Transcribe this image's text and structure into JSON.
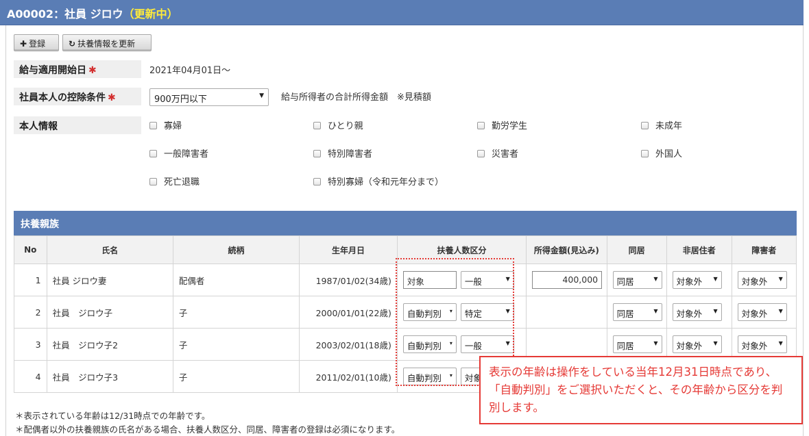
{
  "header": {
    "code": "A00002",
    "separator": "：",
    "name": "社員 ジロウ",
    "status": "（更新中）"
  },
  "toolbar": {
    "register": "登録",
    "update_dependents": "扶養情報を更新"
  },
  "pay_start": {
    "label": "給与適用開始日",
    "required_mark": "✱",
    "value": "2021年04月01日～"
  },
  "deduction": {
    "label": "社員本人の控除条件",
    "required_mark": "✱",
    "selected": "900万円以下",
    "note": "給与所得者の合計所得金額　※見積額"
  },
  "self_info": {
    "label": "本人情報",
    "options": [
      "寡婦",
      "ひとり親",
      "勤労学生",
      "未成年",
      "一般障害者",
      "特別障害者",
      "災害者",
      "外国人",
      "死亡退職",
      "特別寡婦（令和元年分まで）"
    ]
  },
  "dependents": {
    "section_title": "扶養親族",
    "columns": [
      "No",
      "氏名",
      "続柄",
      "生年月日",
      "扶養人数区分",
      "所得金額(見込み)",
      "同居",
      "非居住者",
      "障害者"
    ],
    "rows": [
      {
        "no": "1",
        "name": "社員 ジロウ妻",
        "relation": "配偶者",
        "birth": "1987/01/02(34歳)",
        "category": "対象",
        "category_type": "input",
        "class": "一般",
        "income": "400,000",
        "cohabit": "同居",
        "nonresident": "対象外",
        "disabled": "対象外"
      },
      {
        "no": "2",
        "name": "社員　ジロウ子",
        "relation": "子",
        "birth": "2000/01/01(22歳)",
        "category": "自動判別",
        "category_type": "select",
        "class": "特定",
        "income": "",
        "cohabit": "同居",
        "nonresident": "対象外",
        "disabled": "対象外"
      },
      {
        "no": "3",
        "name": "社員　ジロウ子2",
        "relation": "子",
        "birth": "2003/02/01(18歳)",
        "category": "自動判別",
        "category_type": "select",
        "class": "一般",
        "income": "",
        "cohabit": "同居",
        "nonresident": "対象外",
        "disabled": "対象外"
      },
      {
        "no": "4",
        "name": "社員　ジロウ子3",
        "relation": "子",
        "birth": "2011/02/01(10歳)",
        "category": "自動判別",
        "category_type": "select",
        "class": "対象",
        "income": "",
        "cohabit": "",
        "nonresident": "",
        "disabled": ""
      }
    ]
  },
  "callout": "表示の年齢は操作をしている当年12月31日時点であり、「自動判別」をご選択いただくと、その年齢から区分を判別します。",
  "notes": [
    "＊表示されている年齢は12/31時点での年齢です。",
    "＊配偶者以外の扶養親族の氏名がある場合、扶養人数区分、同居、障害者の登録は必須になります。"
  ],
  "colors": {
    "header_blue": "#5a7db5",
    "status_yellow": "#ffeb3b",
    "alert_red": "#e53935"
  }
}
